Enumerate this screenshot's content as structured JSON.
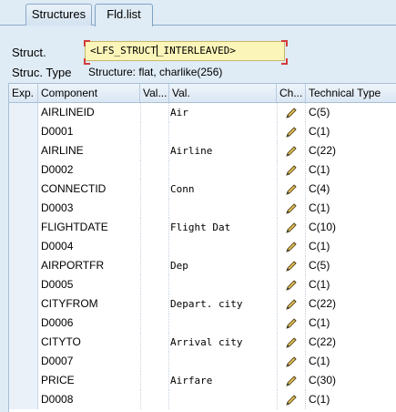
{
  "tabs": [
    {
      "label": "Structures",
      "active": false
    },
    {
      "label": "Fld.list",
      "active": true
    }
  ],
  "struct": {
    "label": "Struct.",
    "value_before_caret": "<LFS_STRUCT",
    "value_after_caret": "_INTERLEAVED>"
  },
  "struct_type": {
    "label": "Struc. Type",
    "value": "Structure: flat, charlike(256)"
  },
  "table": {
    "columns": [
      "Exp.",
      "Component",
      "Val...",
      "Val.",
      "Ch...",
      "Technical Type"
    ],
    "rows": [
      {
        "component": "AIRLINEID",
        "value": "Air",
        "type": "C(5)"
      },
      {
        "component": "D0001",
        "value": "",
        "type": "C(1)"
      },
      {
        "component": "AIRLINE",
        "value": "Airline",
        "type": "C(22)"
      },
      {
        "component": "D0002",
        "value": "",
        "type": "C(1)"
      },
      {
        "component": "CONNECTID",
        "value": "Conn",
        "type": "C(4)"
      },
      {
        "component": "D0003",
        "value": "",
        "type": "C(1)"
      },
      {
        "component": "FLIGHTDATE",
        "value": "Flight Dat",
        "type": "C(10)"
      },
      {
        "component": "D0004",
        "value": "",
        "type": "C(1)"
      },
      {
        "component": "AIRPORTFR",
        "value": "Dep",
        "type": "C(5)"
      },
      {
        "component": "D0005",
        "value": "",
        "type": "C(1)"
      },
      {
        "component": "CITYFROM",
        "value": "Depart. city",
        "type": "C(22)"
      },
      {
        "component": "D0006",
        "value": "",
        "type": "C(1)"
      },
      {
        "component": "CITYTO",
        "value": "Arrival city",
        "type": "C(22)"
      },
      {
        "component": "D0007",
        "value": "",
        "type": "C(1)"
      },
      {
        "component": "PRICE",
        "value": "Airfare",
        "type": "C(30)"
      },
      {
        "component": "D0008",
        "value": "",
        "type": "C(1)"
      }
    ]
  },
  "icons": {
    "change": "pencil-icon"
  },
  "colors": {
    "input_bg": "#fcf5b9",
    "background": "#dfebf5",
    "focus_marker": "#d23c3c"
  }
}
